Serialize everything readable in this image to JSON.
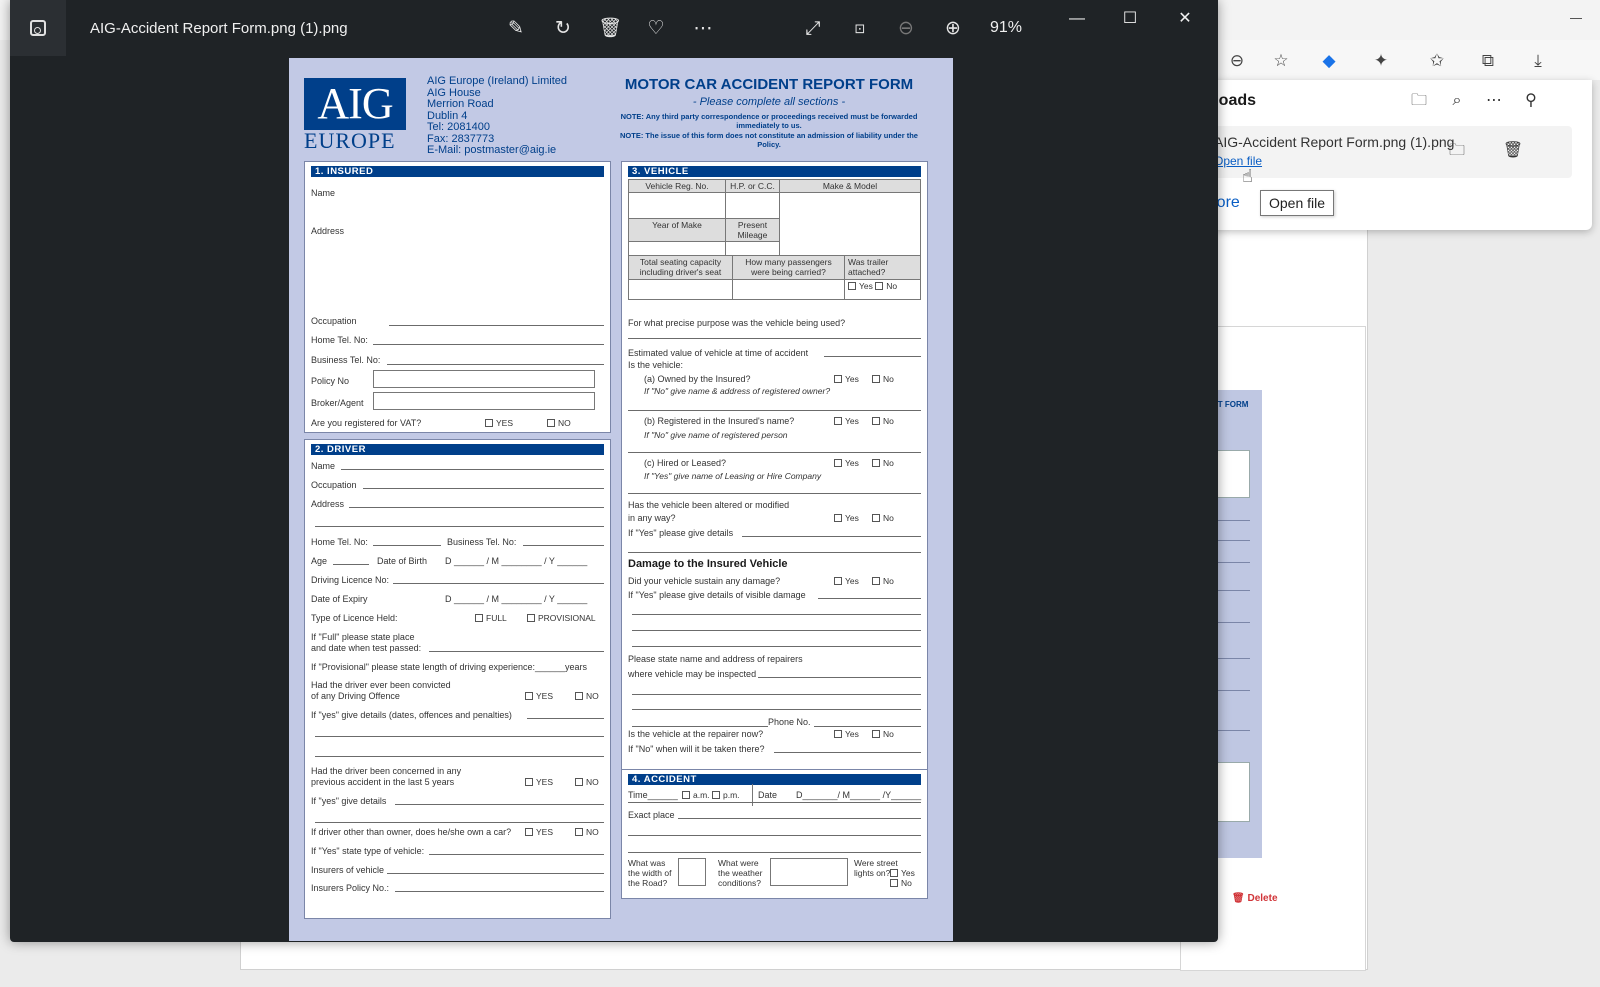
{
  "viewer": {
    "title": "AIG-Accident Report Form.png (1).png",
    "zoom": "91%",
    "tools": [
      "edit-icon",
      "rotate-icon",
      "delete-icon",
      "favorite-icon",
      "more-icon",
      "fullscreen-icon",
      "actual-size-icon",
      "zoom-out-icon",
      "zoom-in-icon"
    ]
  },
  "downloads": {
    "title": "wnloads",
    "file_name": "AIG-Accident Report Form.png (1).png",
    "open_link": "Open file",
    "see_more": "e more",
    "tooltip": "Open file"
  },
  "background": {
    "thumb_title": "RT FORM",
    "delete_label": "Delete"
  },
  "form": {
    "logo_top": "AIG",
    "logo_bottom": "EUROPE",
    "address": [
      "AIG Europe (Ireland) Limited",
      "AIG House",
      "Merrion Road",
      "Dublin 4",
      "Tel: 2081400",
      "Fax: 2837773",
      "E-Mail: postmaster@aig.ie"
    ],
    "title": "MOTOR CAR ACCIDENT REPORT FORM",
    "subtitle": "- Please complete all sections -",
    "note1": "NOTE: Any third party correspondence or proceedings received must be forwarded immediately to us.",
    "note2": "NOTE: The issue of this form does not constitute an admission of liability under the Policy.",
    "insured": {
      "header": "1. INSURED",
      "name": "Name",
      "address": "Address",
      "occupation": "Occupation",
      "home_tel": "Home Tel. No:",
      "business_tel": "Business Tel. No:",
      "policy": "Policy No",
      "broker": "Broker/Agent",
      "vat": "Are you registered for VAT?",
      "yes": "YES",
      "no": "NO"
    },
    "driver": {
      "header": "2. DRIVER",
      "name": "Name",
      "occupation": "Occupation",
      "address": "Address",
      "home_tel": "Home Tel. No:",
      "business_tel": "Business Tel. No:",
      "age": "Age",
      "dob": "Date of Birth",
      "dmy": "D ______ / M ________ / Y ______",
      "licence_no": "Driving Licence No:",
      "expiry": "Date of Expiry",
      "licence_type": "Type of Licence Held:",
      "full": "FULL",
      "provisional": "PROVISIONAL",
      "full_place1": "If \"Full\" please state place",
      "full_place2": "and date when test passed:",
      "prov_length": "If \"Provisional\" please state length of driving experience:______years",
      "convicted1": "Had the driver ever been convicted",
      "convicted2": "of any Driving Offence",
      "yes_details": "If \"yes\" give details (dates, offences and penalties)",
      "accident1": "Had the driver been concerned in any",
      "accident2": "previous accident in the last 5 years",
      "yes_details2": "If \"yes\" give details",
      "own_car": "If driver other than owner, does he/she own a car?",
      "vehicle_type": "If \"Yes\" state type of vehicle:",
      "insurers": "Insurers of vehicle",
      "policy_no": "Insurers Policy No.:",
      "yes": "YES",
      "no": "NO"
    },
    "vehicle": {
      "header": "3. VEHICLE",
      "reg": "Vehicle Reg. No.",
      "hp": "H.P. or C.C.",
      "make": "Make & Model",
      "year": "Year of Make",
      "mileage": "Present Mileage",
      "seating": "Total seating capacity including driver's seat",
      "passengers": "How many passengers were being carried?",
      "trailer": "Was trailer attached?",
      "purpose": "For what precise purpose was the vehicle being used?",
      "value": "Estimated value of vehicle at time of accident",
      "is_vehicle": "Is the vehicle:",
      "owned": "(a) Owned by the Insured?",
      "owned_note": "If \"No\" give name & address of registered owner?",
      "registered": "(b) Registered in the Insured's name?",
      "registered_note": "If \"No\" give name of registered person",
      "hired": "(c) Hired or Leased?",
      "hired_note": "If \"Yes\" give name of Leasing or Hire Company",
      "altered1": "Has the vehicle been altered or modified",
      "altered2": "in any way?",
      "altered_details": "If \"Yes\" please give details",
      "damage_head": "Damage to the Insured Vehicle",
      "damage_q": "Did your vehicle sustain any damage?",
      "damage_details": "If \"Yes\" please give details of visible damage",
      "repairers1": "Please state name and address of repairers",
      "repairers2": "where vehicle may be inspected",
      "phone": "Phone No.",
      "at_repairer": "Is the vehicle at the repairer now?",
      "when_taken": "If \"No\" when will it be taken there?",
      "yes": "Yes",
      "no": "No"
    },
    "accident": {
      "header": "4. ACCIDENT",
      "time": "Time______",
      "am": "a.m.",
      "pm": "p.m.",
      "date": "Date",
      "date_fmt": "D_______/ M______ /Y______",
      "place": "Exact place",
      "road_width": "What was the width of the Road?",
      "weather": "What were the weather conditions?",
      "lights": "Were street lights on?",
      "yes": "Yes",
      "no": "No"
    }
  }
}
